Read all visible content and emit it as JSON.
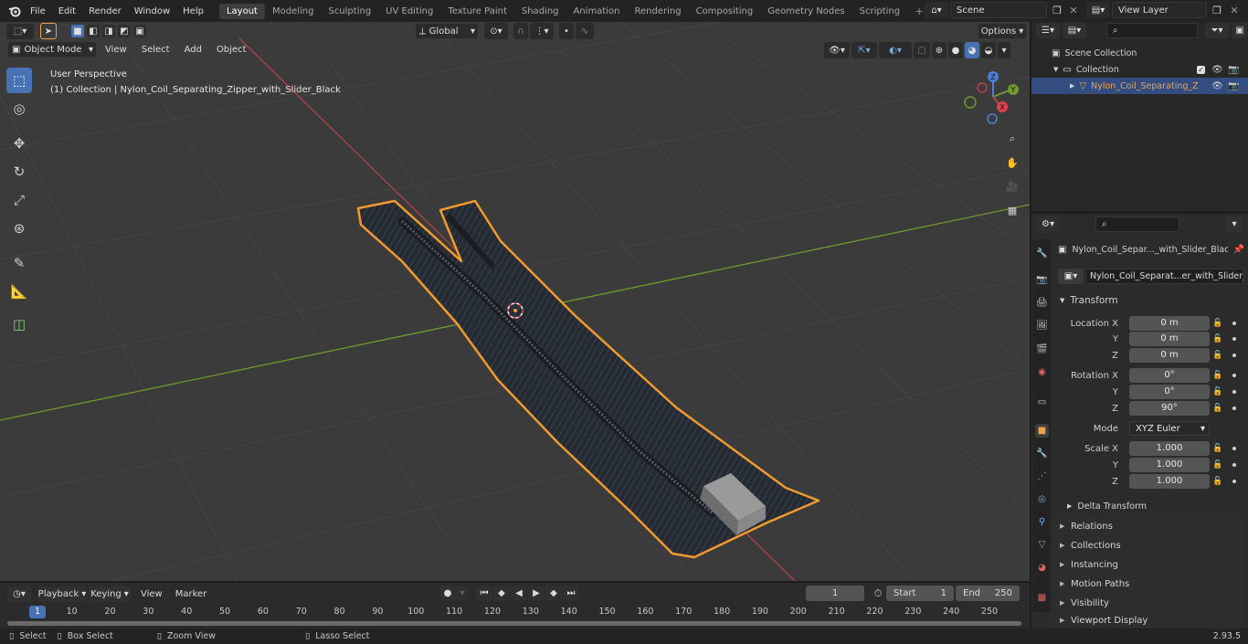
{
  "app": {
    "version": "2.93.5"
  },
  "menubar": {
    "items": [
      "File",
      "Edit",
      "Render",
      "Window",
      "Help"
    ],
    "workspaces": [
      "Layout",
      "Modeling",
      "Sculpting",
      "UV Editing",
      "Texture Paint",
      "Shading",
      "Animation",
      "Rendering",
      "Compositing",
      "Geometry Nodes",
      "Scripting"
    ],
    "active_workspace": "Layout",
    "scene": "Scene",
    "view_layer": "View Layer"
  },
  "viewport_header": {
    "mode": "Object Mode",
    "menus": [
      "View",
      "Select",
      "Add",
      "Object"
    ],
    "transform_orientation": "Global",
    "options_label": "Options"
  },
  "viewport": {
    "perspective_label": "User Perspective",
    "collection_label": "(1) Collection | Nylon_Coil_Separating_Zipper_with_Slider_Black",
    "gizmo_axes": [
      "X",
      "Y",
      "Z"
    ]
  },
  "toolbar": {
    "tools": [
      "select-box-tool",
      "cursor-tool",
      "move-tool",
      "rotate-tool",
      "scale-tool",
      "transform-tool",
      "annotate-tool",
      "measure-tool",
      "add-cube-tool"
    ]
  },
  "outliner": {
    "search_placeholder": "",
    "root": "Scene Collection",
    "collection": "Collection",
    "object": "Nylon_Coil_Separating_Z"
  },
  "properties": {
    "object_name": "Nylon_Coil_Separ..._with_Slider_Black",
    "data_name": "Nylon_Coil_Separat...er_with_Slider_Black",
    "transform_title": "Transform",
    "location_label": "Location X",
    "rotation_label": "Rotation X",
    "scale_label": "Scale X",
    "y_label": "Y",
    "z_label": "Z",
    "location": [
      "0 m",
      "0 m",
      "0 m"
    ],
    "rotation": [
      "0°",
      "0°",
      "90°"
    ],
    "mode_label": "Mode",
    "mode_value": "XYZ Euler",
    "scale": [
      "1.000",
      "1.000",
      "1.000"
    ],
    "delta_transform": "Delta Transform",
    "sections": [
      "Relations",
      "Collections",
      "Instancing",
      "Motion Paths",
      "Visibility",
      "Viewport Display"
    ]
  },
  "timeline": {
    "menus": [
      "Playback",
      "Keying",
      "View",
      "Marker"
    ],
    "current_frame": "1",
    "start_label": "Start",
    "start_value": "1",
    "end_label": "End",
    "end_value": "250",
    "ticks": [
      "1",
      "10",
      "20",
      "30",
      "40",
      "50",
      "60",
      "70",
      "80",
      "90",
      "100",
      "110",
      "120",
      "130",
      "140",
      "150",
      "160",
      "170",
      "180",
      "190",
      "200",
      "210",
      "220",
      "230",
      "240",
      "250"
    ]
  },
  "statusbar": {
    "select": "Select",
    "box_select": "Box Select",
    "zoom_view": "Zoom View",
    "lasso_select": "Lasso Select"
  },
  "colors": {
    "accent": "#4772b3",
    "selection_outline": "#f19a2e",
    "x_axis": "#b34047",
    "y_axis": "#6e9a2e",
    "object_name_active": "#f0a24a"
  }
}
